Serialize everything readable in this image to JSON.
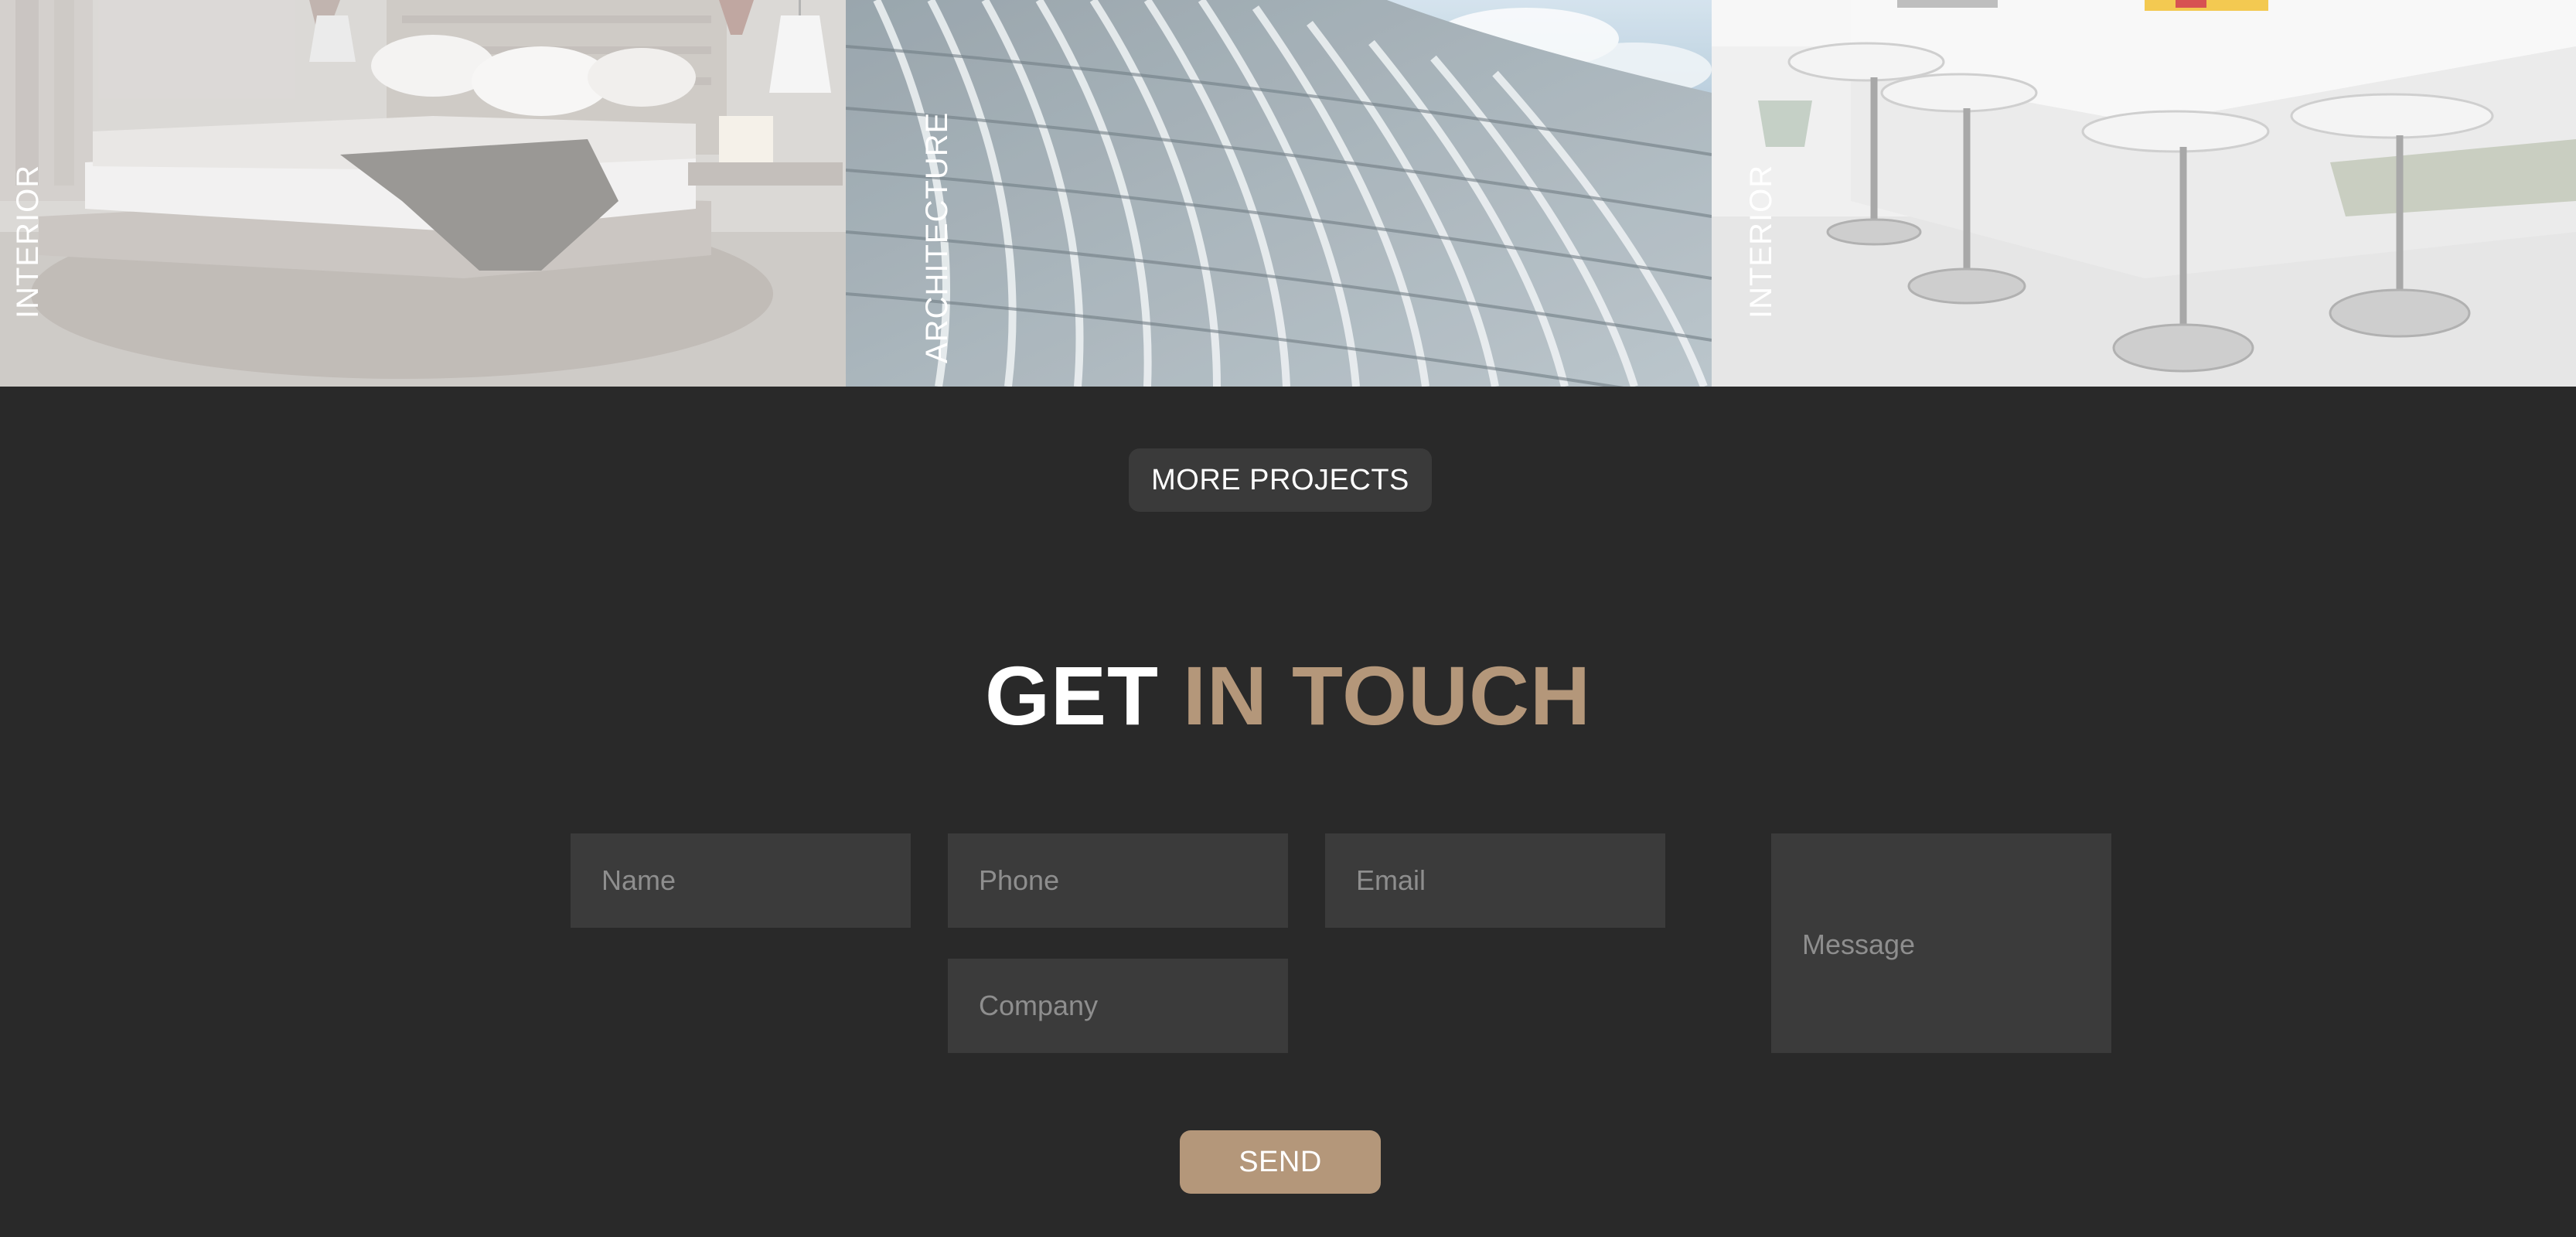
{
  "gallery": {
    "tiles": [
      {
        "label": "INTERIOR"
      },
      {
        "label": "ARCHITECTURE"
      },
      {
        "label": "INTERIOR"
      }
    ]
  },
  "projects": {
    "more_label": "MORE PROJECTS"
  },
  "contact": {
    "title_part1": "GET",
    "title_part2": "IN TOUCH",
    "name_placeholder": "Name",
    "phone_placeholder": "Phone",
    "email_placeholder": "Email",
    "company_placeholder": "Company",
    "message_placeholder": "Message",
    "send_label": "SEND"
  },
  "colors": {
    "background": "#292929",
    "accent": "#b4977a",
    "field_background": "#3b3b3b",
    "button_dark": "#3a3a3a"
  }
}
